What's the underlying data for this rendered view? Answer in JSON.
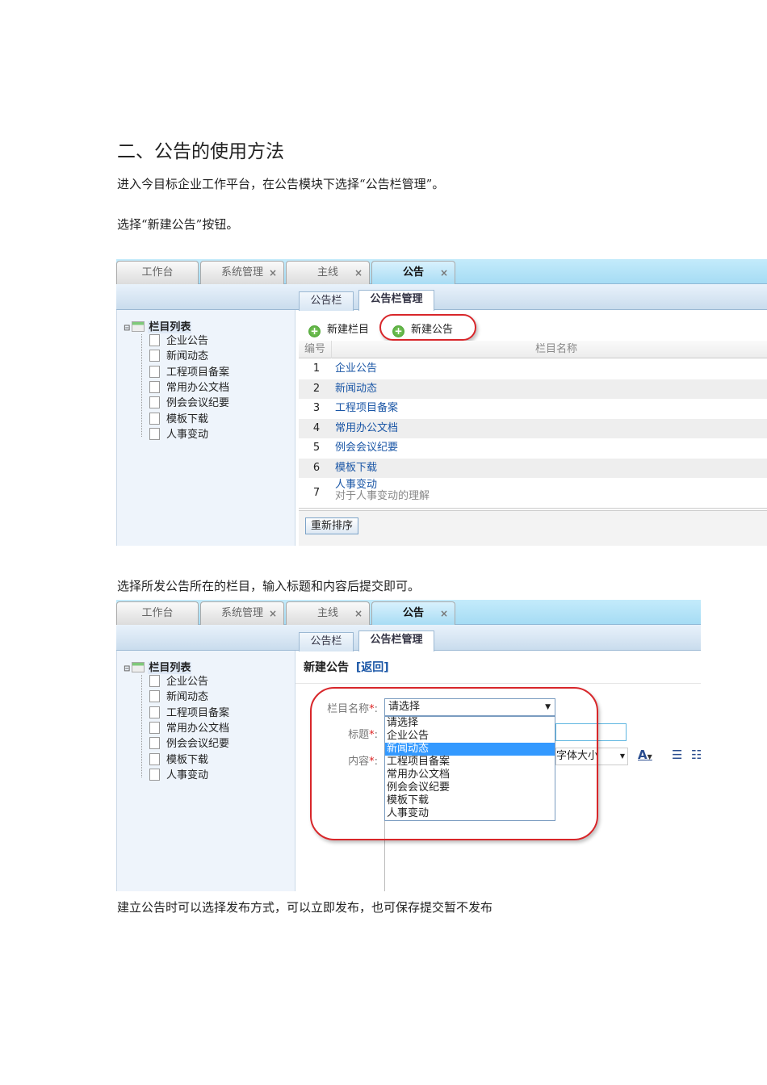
{
  "doc": {
    "heading": "二、公告的使用方法",
    "para1": "进入今目标企业工作平台，在公告模块下选择“公告栏管理”。",
    "para2": "选择“新建公告”按钮。",
    "para3": "选择所发公告所在的栏目，输入标题和内容后提交即可。",
    "para4": "建立公告时可以选择发布方式，可以立即发布，也可保存提交暂不发布"
  },
  "tabs": [
    {
      "label": "工作台",
      "close": ""
    },
    {
      "label": "系统管理",
      "close": "×"
    },
    {
      "label": "主线",
      "close": "×"
    },
    {
      "label": "公告",
      "close": "×"
    }
  ],
  "subtabs": [
    "公告栏",
    "公告栏管理"
  ],
  "tree": {
    "root": "栏目列表",
    "items": [
      "企业公告",
      "新闻动态",
      "工程项目备案",
      "常用办公文档",
      "例会会议纪要",
      "模板下载",
      "人事变动"
    ]
  },
  "list": {
    "new_column": "新建栏目",
    "new_notice": "新建公告",
    "col_num": "编号",
    "col_name": "栏目名称",
    "rows": [
      {
        "n": "1",
        "t": "企业公告"
      },
      {
        "n": "2",
        "t": "新闻动态"
      },
      {
        "n": "3",
        "t": "工程项目备案"
      },
      {
        "n": "4",
        "t": "常用办公文档"
      },
      {
        "n": "5",
        "t": "例会会议纪要"
      },
      {
        "n": "6",
        "t": "模板下载"
      },
      {
        "n": "7",
        "t": "人事变动",
        "sub": "对于人事变动的理解"
      }
    ],
    "reorder": "重新排序"
  },
  "form": {
    "title": "新建公告",
    "back": "[返回]",
    "label_column": "栏目名称",
    "label_title": "标题",
    "label_content": "内容",
    "required": "*",
    "select_value": "请选择",
    "options": [
      "请选择",
      "企业公告",
      "新闻动态",
      "工程项目备案",
      "常用办公文档",
      "例会会议纪要",
      "模板下载",
      "人事变动"
    ],
    "selected_index": 2,
    "font_size": "字体大小"
  }
}
